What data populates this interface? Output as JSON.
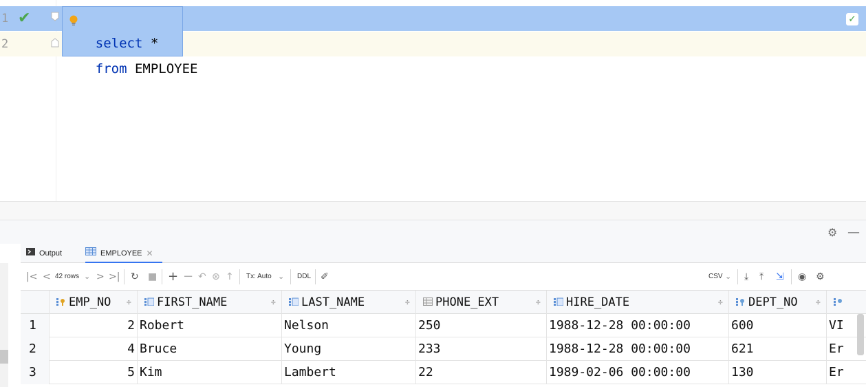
{
  "editor": {
    "lines": [
      {
        "num": "1",
        "code_kw": "select",
        "code_rest": " *"
      },
      {
        "num": "2",
        "code_kw": "from",
        "code_rest": " EMPLOYEE"
      }
    ]
  },
  "tabs": [
    {
      "label": "Output",
      "icon": "console-icon"
    },
    {
      "label": "EMPLOYEE",
      "icon": "table-icon",
      "active": true
    }
  ],
  "toolbar": {
    "rows_label": "42 rows",
    "tx_label": "Tx: Auto",
    "ddl_label": "DDL",
    "export_format": "CSV"
  },
  "grid": {
    "columns": [
      "EMP_NO",
      "FIRST_NAME",
      "LAST_NAME",
      "PHONE_EXT",
      "HIRE_DATE",
      "DEPT_NO"
    ],
    "rows": [
      {
        "rownum": "1",
        "emp_no": "2",
        "first_name": "Robert",
        "last_name": "Nelson",
        "phone_ext": "250",
        "hire_date": "1988-12-28 00:00:00",
        "dept_no": "600",
        "next": "VI"
      },
      {
        "rownum": "2",
        "emp_no": "4",
        "first_name": "Bruce",
        "last_name": "Young",
        "phone_ext": "233",
        "hire_date": "1988-12-28 00:00:00",
        "dept_no": "621",
        "next": "Er"
      },
      {
        "rownum": "3",
        "emp_no": "5",
        "first_name": "Kim",
        "last_name": "Lambert",
        "phone_ext": "22",
        "hire_date": "1989-02-06 00:00:00",
        "dept_no": "130",
        "next": "Er"
      }
    ]
  },
  "colors": {
    "selection": "#a6c8f4",
    "keyword": "#0033b3",
    "check": "#4ca64c",
    "current_line": "#fcfaed"
  }
}
